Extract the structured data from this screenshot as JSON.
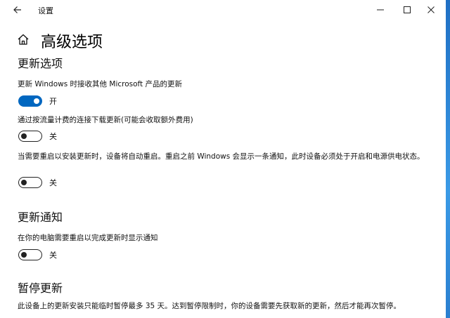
{
  "window": {
    "title": "设置",
    "colors": {
      "accent": "#0067c0",
      "text": "#111111",
      "background": "#ffffff"
    }
  },
  "page": {
    "title": "高级选项"
  },
  "update_options": {
    "heading": "更新选项",
    "settings": [
      {
        "desc": "更新 Windows 时接收其他 Microsoft 产品的更新",
        "state": "开",
        "on": true
      },
      {
        "desc": "通过按流量计费的连接下载更新(可能会收取额外费用)",
        "state": "关",
        "on": false
      },
      {
        "desc": "当需要重启以安装更新时，设备将自动重启。重启之前 Windows 会显示一条通知，此时设备必须处于开启和电源供电状态。",
        "state": "关",
        "on": false
      }
    ]
  },
  "update_notifications": {
    "heading": "更新通知",
    "settings": [
      {
        "desc": "在你的电脑需要重启以完成更新时显示通知",
        "state": "关",
        "on": false
      }
    ]
  },
  "pause_updates": {
    "heading": "暂停更新",
    "desc": "此设备上的更新安装只能临时暂停最多 35 天。达到暂停限制时，你的设备需要先获取新的更新，然后才能再次暂停。"
  },
  "icons": {
    "back": "arrow-left-icon",
    "home": "home-icon",
    "minimize": "minimize-icon",
    "maximize": "maximize-icon",
    "close": "close-icon"
  }
}
